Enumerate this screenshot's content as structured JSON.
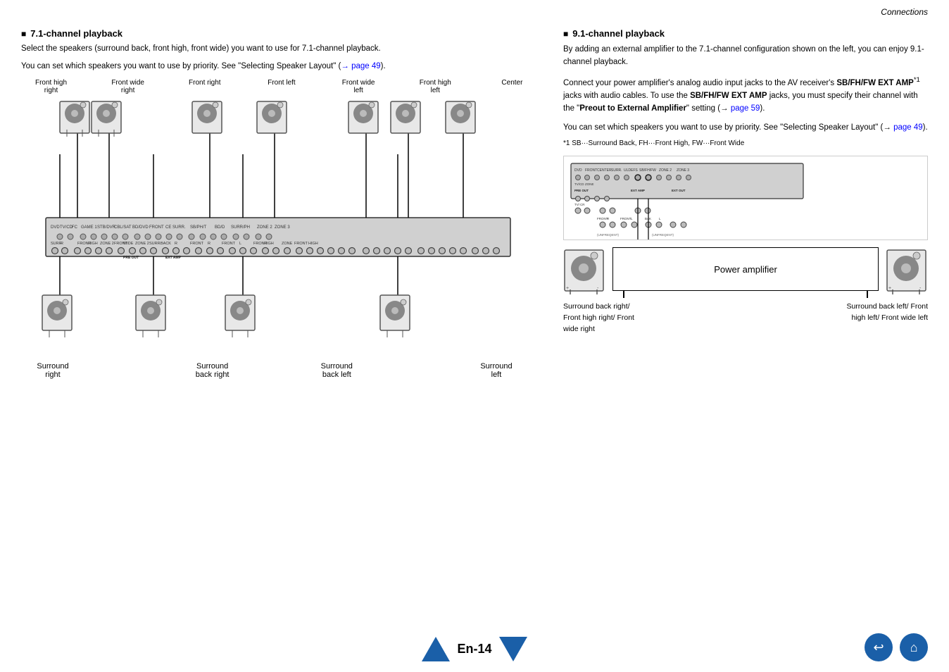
{
  "header": {
    "section_label": "Connections"
  },
  "left_section": {
    "title": "7.1-channel playback",
    "desc1": "Select the speakers (surround back, front high, front wide) you want to use for 7.1-channel playback.",
    "desc2": "You can set which speakers you want to use by priority. See \"Selecting Speaker Layout\" (→ page 49).",
    "link1": "→ page 49"
  },
  "speaker_labels_top": [
    {
      "id": "front-high-right",
      "line1": "Front high",
      "line2": "right"
    },
    {
      "id": "front-wide-right",
      "line1": "Front wide",
      "line2": "right"
    },
    {
      "id": "front-right",
      "line1": "Front right",
      "line2": ""
    },
    {
      "id": "front-left",
      "line1": "Front left",
      "line2": ""
    },
    {
      "id": "front-wide-left",
      "line1": "Front wide",
      "line2": "left"
    },
    {
      "id": "front-high-left",
      "line1": "Front high",
      "line2": "left"
    },
    {
      "id": "center",
      "line1": "Center",
      "line2": ""
    }
  ],
  "speaker_labels_bottom": [
    {
      "id": "surround-right",
      "text": "Surround\nright"
    },
    {
      "id": "surround-back-right",
      "text": "Surround\nback right"
    },
    {
      "id": "surround-back-left",
      "text": "Surround\nback left"
    },
    {
      "id": "surround-left",
      "text": "Surround\nleft"
    }
  ],
  "right_section": {
    "title": "9.1-channel playback",
    "desc1": "By adding an external amplifier to the 7.1-channel configuration shown on the left, you can enjoy 9.1-channel playback.",
    "desc2": "Connect your power amplifier's analog audio input jacks to the AV receiver's ",
    "bold1": "SB/FH/FW EXT AMP",
    "sup1": "*1",
    "desc3": " jacks with audio cables. To use the ",
    "bold2": "SB/FH/FW EXT AMP",
    "desc4": " jacks, you must specify their channel with the \"",
    "bold3": "Preout to External Amplifier",
    "desc5": "\" setting (→ ",
    "link2": "page 59",
    "desc6": ").",
    "desc7": "You can set which speakers you want to use by priority. See \"Selecting Speaker Layout\" (→ ",
    "link3": "page 49",
    "desc8": ").",
    "footnote": "*1  SB···Surround Back, FH···Front High, FW···Front Wide",
    "power_amp_label": "Power amplifier",
    "label_left": "Surround back right/\nFront high right/\nFront wide right",
    "label_right": "Surround back left/\nFront high left/\nFront wide left"
  },
  "bottom": {
    "page_number": "En-14",
    "nav_up": "▲",
    "nav_down": "▼",
    "back_icon": "↩",
    "home_icon": "⌂"
  }
}
